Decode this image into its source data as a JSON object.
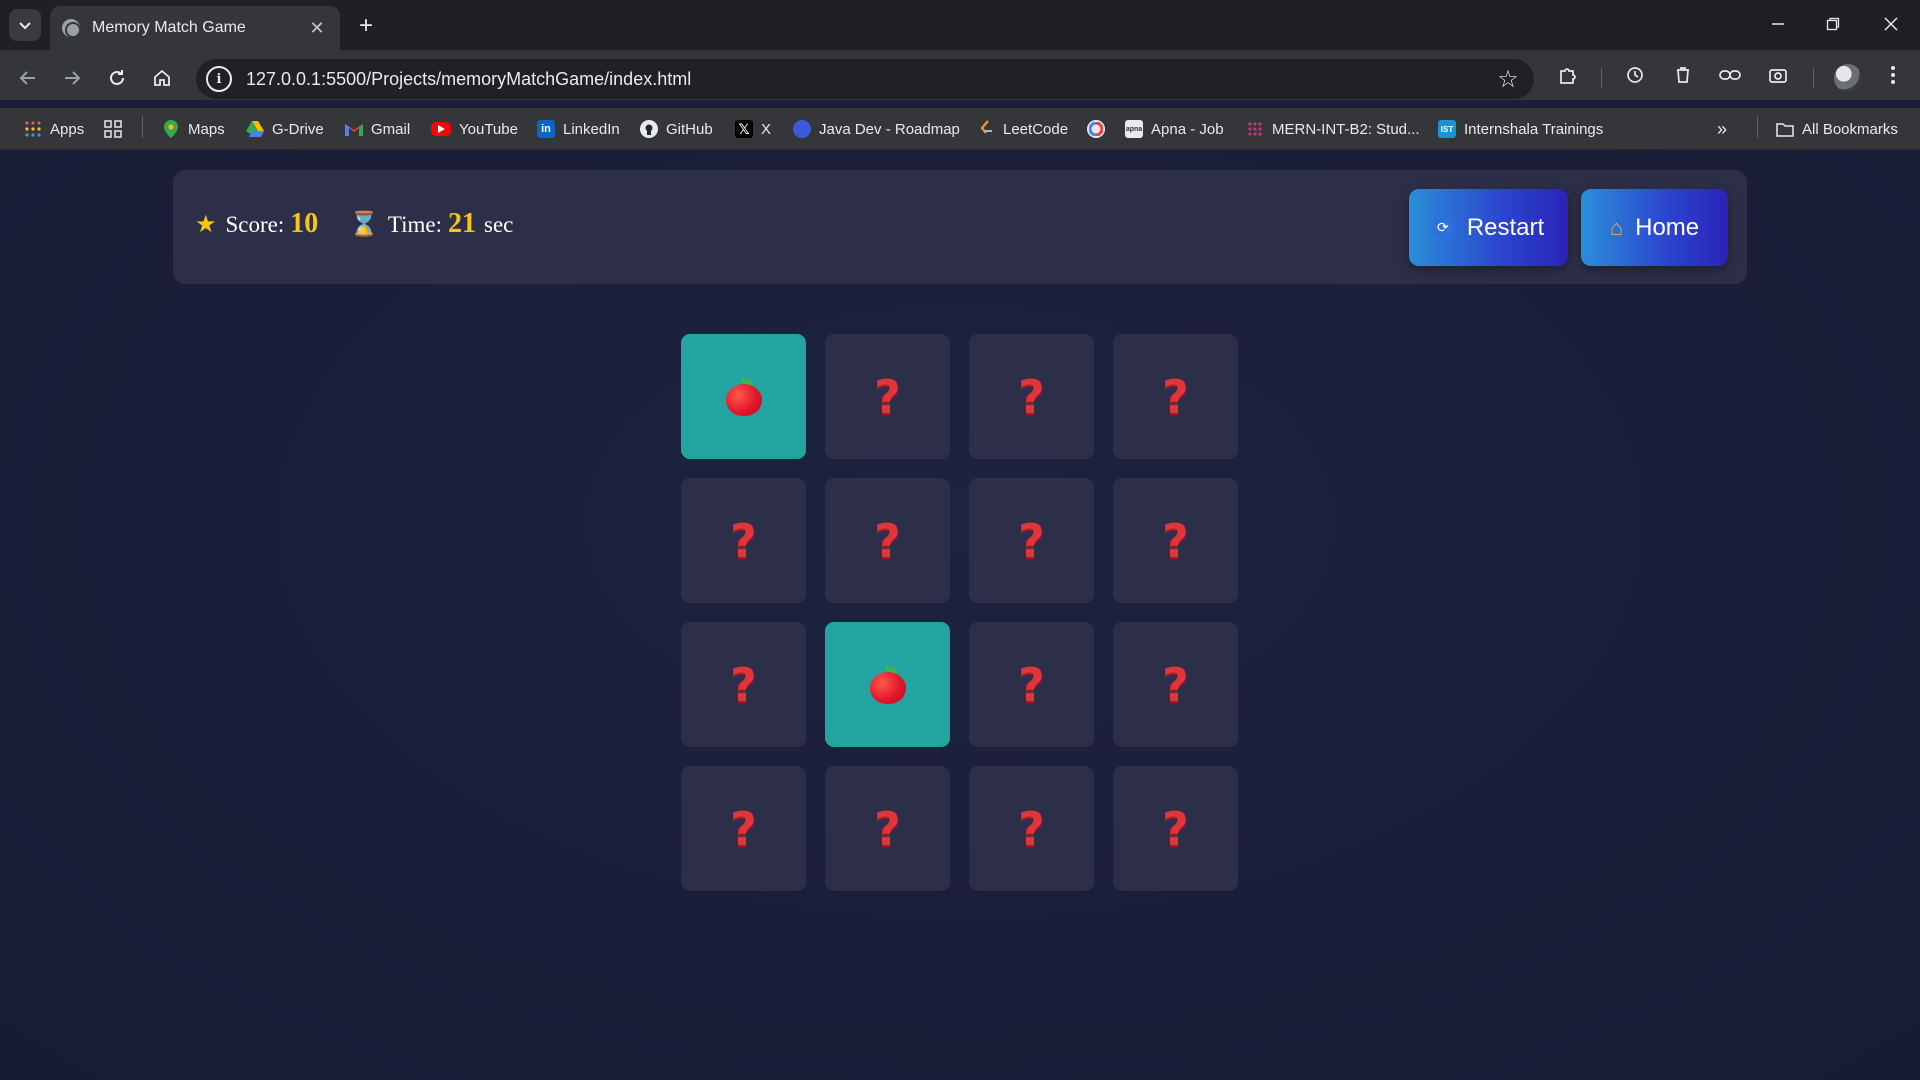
{
  "browser": {
    "tab": {
      "title": "Memory Match Game"
    },
    "url": "127.0.0.1:5500/Projects/memoryMatchGame/index.html",
    "bookmarks": [
      {
        "label": "Apps",
        "icon": "apps-grid-icon"
      },
      {
        "label": "Maps",
        "icon": "maps-icon"
      },
      {
        "label": "G-Drive",
        "icon": "google-drive-icon"
      },
      {
        "label": "Gmail",
        "icon": "gmail-icon"
      },
      {
        "label": "YouTube",
        "icon": "youtube-icon"
      },
      {
        "label": "LinkedIn",
        "icon": "linkedin-icon"
      },
      {
        "label": "GitHub",
        "icon": "github-icon"
      },
      {
        "label": "X",
        "icon": "x-icon"
      },
      {
        "label": "Java Dev - Roadmap",
        "icon": "roadmap-icon"
      },
      {
        "label": "LeetCode",
        "icon": "leetcode-icon"
      },
      {
        "label": "Apna - Job",
        "icon": "apna-icon"
      },
      {
        "label": "MERN-INT-B2: Stud...",
        "icon": "slack-icon"
      },
      {
        "label": "Internshala Trainings",
        "icon": "internshala-icon"
      }
    ],
    "all_bookmarks": "All Bookmarks",
    "apna_badge": "apna",
    "ist_badge": "IST"
  },
  "game": {
    "score_label": "Score:",
    "score": "10",
    "time_label": "Time:",
    "time": "21",
    "time_unit": "sec",
    "restart_label": "Restart",
    "home_label": "Home",
    "cards": [
      {
        "state": "flipped",
        "face": "apple"
      },
      {
        "state": "hidden",
        "face": "?"
      },
      {
        "state": "hidden",
        "face": "?"
      },
      {
        "state": "hidden",
        "face": "?"
      },
      {
        "state": "hidden",
        "face": "?"
      },
      {
        "state": "hidden",
        "face": "?"
      },
      {
        "state": "hidden",
        "face": "?"
      },
      {
        "state": "hidden",
        "face": "?"
      },
      {
        "state": "hidden",
        "face": "?"
      },
      {
        "state": "flipped",
        "face": "apple"
      },
      {
        "state": "hidden",
        "face": "?"
      },
      {
        "state": "hidden",
        "face": "?"
      },
      {
        "state": "hidden",
        "face": "?"
      },
      {
        "state": "hidden",
        "face": "?"
      },
      {
        "state": "hidden",
        "face": "?"
      },
      {
        "state": "hidden",
        "face": "?"
      }
    ]
  },
  "colors": {
    "background": "#1b1f36",
    "panel": "#2c2f47",
    "flipped_card": "#24a4a1",
    "question_mark": "#e3343b",
    "stat_number": "#f5c518"
  }
}
